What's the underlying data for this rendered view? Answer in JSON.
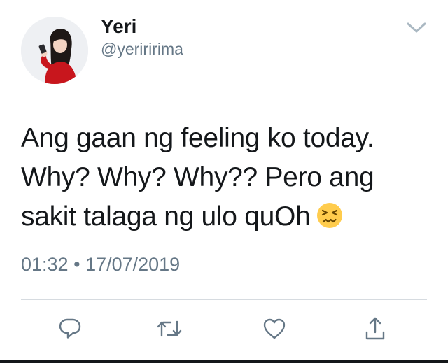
{
  "user": {
    "display_name": "Yeri",
    "handle": "@yeriririma",
    "avatar": "profile-photo"
  },
  "tweet": {
    "lines": [
      "Ang gaan ng feeling ko today.",
      "Why? Why? Why?? Pero ang",
      "sakit talaga ng ulo quOh"
    ],
    "emoji": "confounded-face-emoji",
    "time": "01:32",
    "separator": "•",
    "date": "17/07/2019"
  },
  "actions": {
    "reply": "reply-icon",
    "retweet": "retweet-icon",
    "like": "heart-icon",
    "share": "share-icon"
  },
  "menu": {
    "caret": "chevron-down-icon"
  },
  "colors": {
    "text": "#14171a",
    "secondary": "#657786",
    "divider": "#d6dbe0",
    "emoji": "#ffcc4d"
  }
}
